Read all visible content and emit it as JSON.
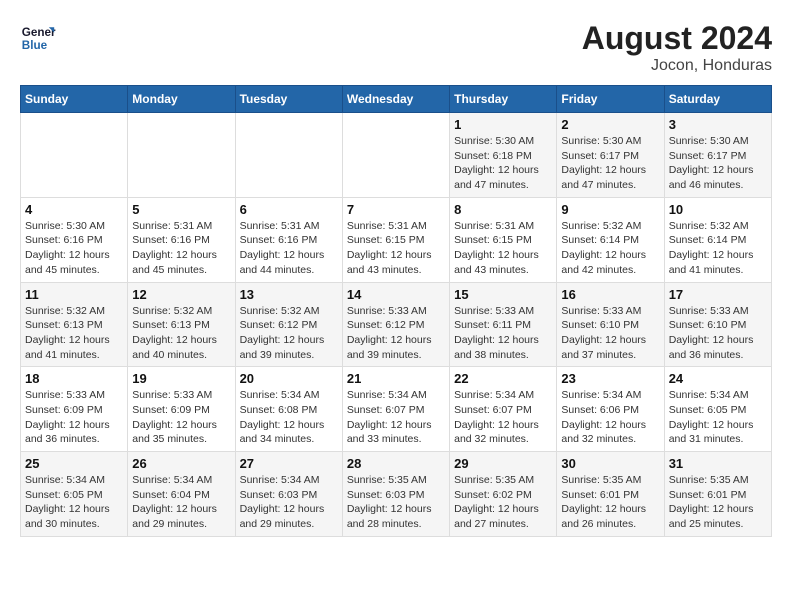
{
  "logo": {
    "line1": "General",
    "line2": "Blue"
  },
  "title": "August 2024",
  "subtitle": "Jocon, Honduras",
  "days_of_week": [
    "Sunday",
    "Monday",
    "Tuesday",
    "Wednesday",
    "Thursday",
    "Friday",
    "Saturday"
  ],
  "weeks": [
    [
      {
        "day": "",
        "info": ""
      },
      {
        "day": "",
        "info": ""
      },
      {
        "day": "",
        "info": ""
      },
      {
        "day": "",
        "info": ""
      },
      {
        "day": "1",
        "info": "Sunrise: 5:30 AM\nSunset: 6:18 PM\nDaylight: 12 hours\nand 47 minutes."
      },
      {
        "day": "2",
        "info": "Sunrise: 5:30 AM\nSunset: 6:17 PM\nDaylight: 12 hours\nand 47 minutes."
      },
      {
        "day": "3",
        "info": "Sunrise: 5:30 AM\nSunset: 6:17 PM\nDaylight: 12 hours\nand 46 minutes."
      }
    ],
    [
      {
        "day": "4",
        "info": "Sunrise: 5:30 AM\nSunset: 6:16 PM\nDaylight: 12 hours\nand 45 minutes."
      },
      {
        "day": "5",
        "info": "Sunrise: 5:31 AM\nSunset: 6:16 PM\nDaylight: 12 hours\nand 45 minutes."
      },
      {
        "day": "6",
        "info": "Sunrise: 5:31 AM\nSunset: 6:16 PM\nDaylight: 12 hours\nand 44 minutes."
      },
      {
        "day": "7",
        "info": "Sunrise: 5:31 AM\nSunset: 6:15 PM\nDaylight: 12 hours\nand 43 minutes."
      },
      {
        "day": "8",
        "info": "Sunrise: 5:31 AM\nSunset: 6:15 PM\nDaylight: 12 hours\nand 43 minutes."
      },
      {
        "day": "9",
        "info": "Sunrise: 5:32 AM\nSunset: 6:14 PM\nDaylight: 12 hours\nand 42 minutes."
      },
      {
        "day": "10",
        "info": "Sunrise: 5:32 AM\nSunset: 6:14 PM\nDaylight: 12 hours\nand 41 minutes."
      }
    ],
    [
      {
        "day": "11",
        "info": "Sunrise: 5:32 AM\nSunset: 6:13 PM\nDaylight: 12 hours\nand 41 minutes."
      },
      {
        "day": "12",
        "info": "Sunrise: 5:32 AM\nSunset: 6:13 PM\nDaylight: 12 hours\nand 40 minutes."
      },
      {
        "day": "13",
        "info": "Sunrise: 5:32 AM\nSunset: 6:12 PM\nDaylight: 12 hours\nand 39 minutes."
      },
      {
        "day": "14",
        "info": "Sunrise: 5:33 AM\nSunset: 6:12 PM\nDaylight: 12 hours\nand 39 minutes."
      },
      {
        "day": "15",
        "info": "Sunrise: 5:33 AM\nSunset: 6:11 PM\nDaylight: 12 hours\nand 38 minutes."
      },
      {
        "day": "16",
        "info": "Sunrise: 5:33 AM\nSunset: 6:10 PM\nDaylight: 12 hours\nand 37 minutes."
      },
      {
        "day": "17",
        "info": "Sunrise: 5:33 AM\nSunset: 6:10 PM\nDaylight: 12 hours\nand 36 minutes."
      }
    ],
    [
      {
        "day": "18",
        "info": "Sunrise: 5:33 AM\nSunset: 6:09 PM\nDaylight: 12 hours\nand 36 minutes."
      },
      {
        "day": "19",
        "info": "Sunrise: 5:33 AM\nSunset: 6:09 PM\nDaylight: 12 hours\nand 35 minutes."
      },
      {
        "day": "20",
        "info": "Sunrise: 5:34 AM\nSunset: 6:08 PM\nDaylight: 12 hours\nand 34 minutes."
      },
      {
        "day": "21",
        "info": "Sunrise: 5:34 AM\nSunset: 6:07 PM\nDaylight: 12 hours\nand 33 minutes."
      },
      {
        "day": "22",
        "info": "Sunrise: 5:34 AM\nSunset: 6:07 PM\nDaylight: 12 hours\nand 32 minutes."
      },
      {
        "day": "23",
        "info": "Sunrise: 5:34 AM\nSunset: 6:06 PM\nDaylight: 12 hours\nand 32 minutes."
      },
      {
        "day": "24",
        "info": "Sunrise: 5:34 AM\nSunset: 6:05 PM\nDaylight: 12 hours\nand 31 minutes."
      }
    ],
    [
      {
        "day": "25",
        "info": "Sunrise: 5:34 AM\nSunset: 6:05 PM\nDaylight: 12 hours\nand 30 minutes."
      },
      {
        "day": "26",
        "info": "Sunrise: 5:34 AM\nSunset: 6:04 PM\nDaylight: 12 hours\nand 29 minutes."
      },
      {
        "day": "27",
        "info": "Sunrise: 5:34 AM\nSunset: 6:03 PM\nDaylight: 12 hours\nand 29 minutes."
      },
      {
        "day": "28",
        "info": "Sunrise: 5:35 AM\nSunset: 6:03 PM\nDaylight: 12 hours\nand 28 minutes."
      },
      {
        "day": "29",
        "info": "Sunrise: 5:35 AM\nSunset: 6:02 PM\nDaylight: 12 hours\nand 27 minutes."
      },
      {
        "day": "30",
        "info": "Sunrise: 5:35 AM\nSunset: 6:01 PM\nDaylight: 12 hours\nand 26 minutes."
      },
      {
        "day": "31",
        "info": "Sunrise: 5:35 AM\nSunset: 6:01 PM\nDaylight: 12 hours\nand 25 minutes."
      }
    ]
  ]
}
